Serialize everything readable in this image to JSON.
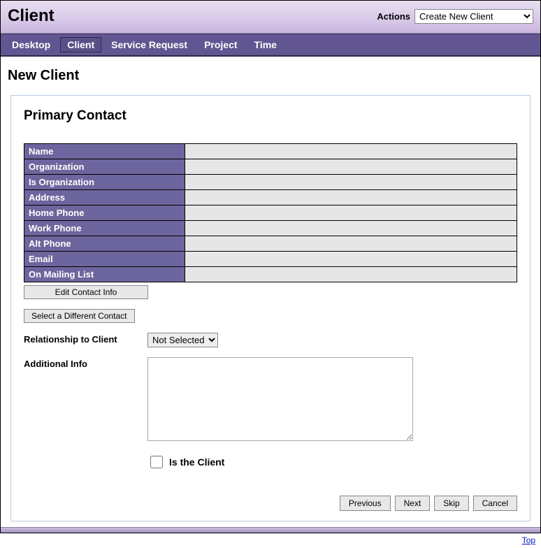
{
  "header": {
    "title": "Client",
    "actions_label": "Actions",
    "actions_selected": "Create New Client"
  },
  "nav": {
    "items": [
      {
        "label": "Desktop",
        "active": false
      },
      {
        "label": "Client",
        "active": true
      },
      {
        "label": "Service Request",
        "active": false
      },
      {
        "label": "Project",
        "active": false
      },
      {
        "label": "Time",
        "active": false
      }
    ]
  },
  "page_title": "New Client",
  "panel": {
    "heading": "Primary Contact",
    "rows": [
      {
        "label": "Name",
        "value": ""
      },
      {
        "label": "Organization",
        "value": ""
      },
      {
        "label": "Is Organization",
        "value": ""
      },
      {
        "label": "Address",
        "value": ""
      },
      {
        "label": "Home Phone",
        "value": ""
      },
      {
        "label": "Work Phone",
        "value": ""
      },
      {
        "label": "Alt Phone",
        "value": ""
      },
      {
        "label": "Email",
        "value": ""
      },
      {
        "label": "On Mailing List",
        "value": ""
      }
    ],
    "edit_contact_label": "Edit Contact Info",
    "select_different_label": "Select a Different Contact",
    "relationship_label": "Relationship to Client",
    "relationship_selected": "Not Selected",
    "additional_info_label": "Additional Info",
    "additional_info_value": "",
    "is_client_label": "Is the Client",
    "is_client_checked": false
  },
  "wizard": {
    "previous": "Previous",
    "next": "Next",
    "skip": "Skip",
    "cancel": "Cancel"
  },
  "top_link": "Top"
}
